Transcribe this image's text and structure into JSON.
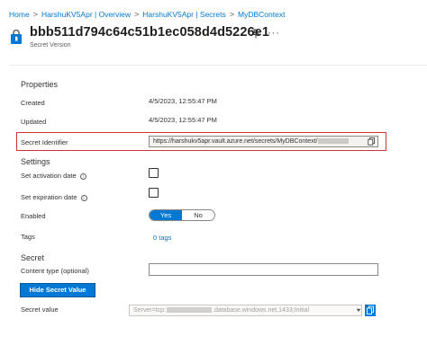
{
  "breadcrumb": {
    "items": [
      "Home",
      "HarshuKV5Apr | Overview",
      "HarshuKV5Apr | Secrets",
      "MyDBContext"
    ],
    "separator": ">"
  },
  "header": {
    "title": "bbb511d794c64c51b1ec058d4d5226e1",
    "subtitle": "Secret Version",
    "more": "···"
  },
  "properties": {
    "heading": "Properties",
    "created_label": "Created",
    "created_value": "4/5/2023, 12:55:47 PM",
    "updated_label": "Updated",
    "updated_value": "4/5/2023, 12:55:47 PM",
    "identifier_label": "Secret Identifier",
    "identifier_value": "https://harshukv5apr.vault.azure.net/secrets/MyDBContext/"
  },
  "settings": {
    "heading": "Settings",
    "activation_label": "Set activation date",
    "expiration_label": "Set expiration date",
    "activation_checked": false,
    "expiration_checked": false,
    "enabled_label": "Enabled",
    "enabled_yes": "Yes",
    "enabled_no": "No",
    "enabled_selected": "Yes",
    "tags_label": "Tags",
    "tags_value": "0 tags"
  },
  "secret": {
    "heading": "Secret",
    "content_type_label": "Content type (optional)",
    "content_type_value": "",
    "hide_button": "Hide Secret Value",
    "value_label": "Secret value",
    "value_prefix": "Server=tcp:",
    "value_suffix": ".database.windows.net,1433;Initial"
  },
  "colors": {
    "accent": "#0078d4",
    "highlight_border": "#d13438",
    "text": "#323130"
  },
  "icons": {
    "key": "key-icon",
    "pin": "pin-icon",
    "info": "info-icon",
    "copy": "copy-icon",
    "dropdown": "chevron-down-icon"
  }
}
